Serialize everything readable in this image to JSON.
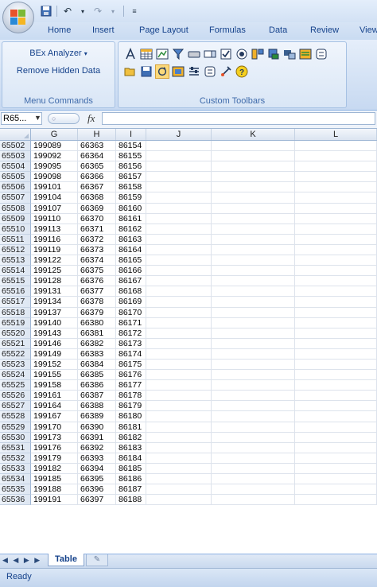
{
  "qat": {
    "save_icon": "save-icon",
    "undo_icon": "undo-icon",
    "redo_icon": "redo-icon",
    "customize_icon": "customize-qat-icon"
  },
  "tabs": [
    "Home",
    "Insert",
    "Page Layout",
    "Formulas",
    "Data",
    "Review",
    "View"
  ],
  "ribbon": {
    "menu_commands": {
      "label": "Menu Commands",
      "bex_analyzer": "BEx Analyzer",
      "bex_arrow": "▾",
      "remove_hidden": "Remove Hidden Data"
    },
    "custom_toolbars": {
      "label": "Custom Toolbars"
    }
  },
  "formula_bar": {
    "name_box": "R65...",
    "fx_label": "fx",
    "value": ""
  },
  "columns": [
    "G",
    "H",
    "I",
    "J",
    "K",
    "L"
  ],
  "rows": [
    {
      "r": "65502",
      "G": "199089",
      "H": "66363",
      "I": "86154"
    },
    {
      "r": "65503",
      "G": "199092",
      "H": "66364",
      "I": "86155"
    },
    {
      "r": "65504",
      "G": "199095",
      "H": "66365",
      "I": "86156"
    },
    {
      "r": "65505",
      "G": "199098",
      "H": "66366",
      "I": "86157"
    },
    {
      "r": "65506",
      "G": "199101",
      "H": "66367",
      "I": "86158"
    },
    {
      "r": "65507",
      "G": "199104",
      "H": "66368",
      "I": "86159"
    },
    {
      "r": "65508",
      "G": "199107",
      "H": "66369",
      "I": "86160"
    },
    {
      "r": "65509",
      "G": "199110",
      "H": "66370",
      "I": "86161"
    },
    {
      "r": "65510",
      "G": "199113",
      "H": "66371",
      "I": "86162"
    },
    {
      "r": "65511",
      "G": "199116",
      "H": "66372",
      "I": "86163"
    },
    {
      "r": "65512",
      "G": "199119",
      "H": "66373",
      "I": "86164"
    },
    {
      "r": "65513",
      "G": "199122",
      "H": "66374",
      "I": "86165"
    },
    {
      "r": "65514",
      "G": "199125",
      "H": "66375",
      "I": "86166"
    },
    {
      "r": "65515",
      "G": "199128",
      "H": "66376",
      "I": "86167"
    },
    {
      "r": "65516",
      "G": "199131",
      "H": "66377",
      "I": "86168"
    },
    {
      "r": "65517",
      "G": "199134",
      "H": "66378",
      "I": "86169"
    },
    {
      "r": "65518",
      "G": "199137",
      "H": "66379",
      "I": "86170"
    },
    {
      "r": "65519",
      "G": "199140",
      "H": "66380",
      "I": "86171"
    },
    {
      "r": "65520",
      "G": "199143",
      "H": "66381",
      "I": "86172"
    },
    {
      "r": "65521",
      "G": "199146",
      "H": "66382",
      "I": "86173"
    },
    {
      "r": "65522",
      "G": "199149",
      "H": "66383",
      "I": "86174"
    },
    {
      "r": "65523",
      "G": "199152",
      "H": "66384",
      "I": "86175"
    },
    {
      "r": "65524",
      "G": "199155",
      "H": "66385",
      "I": "86176"
    },
    {
      "r": "65525",
      "G": "199158",
      "H": "66386",
      "I": "86177"
    },
    {
      "r": "65526",
      "G": "199161",
      "H": "66387",
      "I": "86178"
    },
    {
      "r": "65527",
      "G": "199164",
      "H": "66388",
      "I": "86179"
    },
    {
      "r": "65528",
      "G": "199167",
      "H": "66389",
      "I": "86180"
    },
    {
      "r": "65529",
      "G": "199170",
      "H": "66390",
      "I": "86181"
    },
    {
      "r": "65530",
      "G": "199173",
      "H": "66391",
      "I": "86182"
    },
    {
      "r": "65531",
      "G": "199176",
      "H": "66392",
      "I": "86183"
    },
    {
      "r": "65532",
      "G": "199179",
      "H": "66393",
      "I": "86184"
    },
    {
      "r": "65533",
      "G": "199182",
      "H": "66394",
      "I": "86185"
    },
    {
      "r": "65534",
      "G": "199185",
      "H": "66395",
      "I": "86186"
    },
    {
      "r": "65535",
      "G": "199188",
      "H": "66396",
      "I": "86187"
    },
    {
      "r": "65536",
      "G": "199191",
      "H": "66397",
      "I": "86188"
    }
  ],
  "sheet_tabs": {
    "active": "Table",
    "nav": "◀ ◀ ▶ ▶"
  },
  "status": {
    "text": "Ready"
  }
}
